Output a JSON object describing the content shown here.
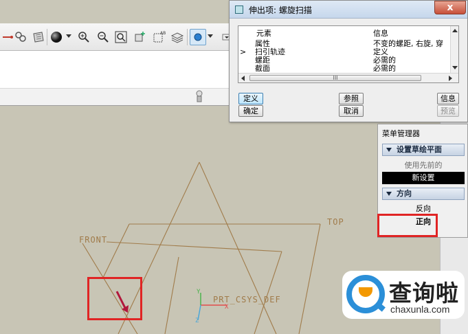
{
  "dialog": {
    "title": "伸出项: 螺旋扫描",
    "columns": {
      "element": "元素",
      "info": "信息"
    },
    "rows": [
      {
        "marker": "",
        "element": "属性",
        "info": "不变的螺距, 右旋, 穿"
      },
      {
        "marker": ">",
        "element": "扫引轨迹",
        "info": "定义"
      },
      {
        "marker": "",
        "element": "螺距",
        "info": "必需的"
      },
      {
        "marker": "",
        "element": "截面",
        "info": "必需的"
      }
    ],
    "scroll_thumb_glyph": "III",
    "close_glyph": "x",
    "buttons": {
      "define": "定义",
      "reference": "参照",
      "info": "信息",
      "ok": "确定",
      "cancel": "取消",
      "preview": "预览"
    }
  },
  "menu_manager": {
    "title": "菜单管理器",
    "section1_header": "设置草绘平面",
    "section1_items": [
      "使用先前的",
      "新设置"
    ],
    "section2_header": "方向",
    "section2_items": [
      "反向",
      "正向"
    ]
  },
  "graphics": {
    "datum_labels": {
      "front": "FRONT",
      "top": "TOP",
      "csys": "PRT_CSYS_DEF"
    },
    "axes": {
      "x": "X",
      "y": "Y",
      "z": "Z"
    }
  },
  "watermark": {
    "name": "查询啦",
    "url": "chaxunla.com"
  },
  "colors": {
    "datum": "#a07b4a",
    "highlight": "#e02424",
    "accent_blue": "#2b8fd8",
    "arrow": "#b1173b"
  },
  "icons": [
    "sketch-icon",
    "datum-plane-icon",
    "shading-icon",
    "zoom-in-icon",
    "zoom-out-icon",
    "refit-icon",
    "reorient-icon",
    "layers-icon",
    "display-style-icon"
  ]
}
